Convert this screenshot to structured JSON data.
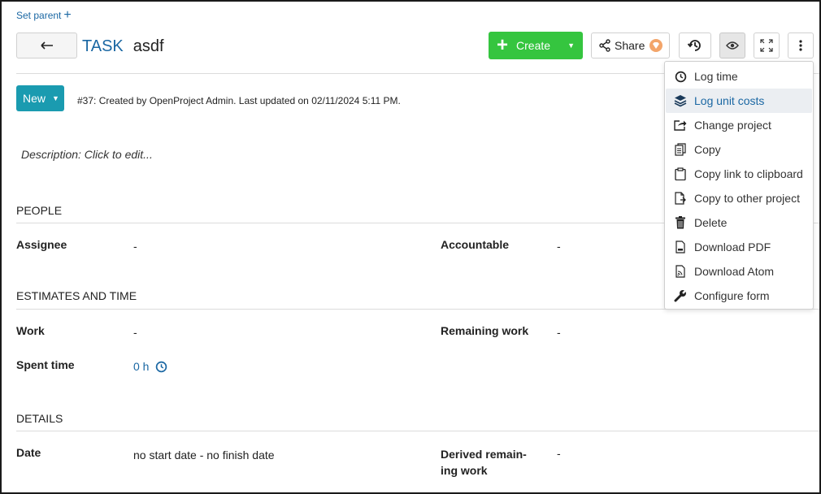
{
  "header": {
    "set_parent": "Set parent",
    "type": "TASK",
    "subject": "asdf",
    "create_label": "Create",
    "share_label": "Share"
  },
  "status": {
    "label": "New",
    "meta": "#37: Created by OpenProject Admin. Last updated on 02/11/2024 5:11 PM."
  },
  "description_placeholder": "Description: Click to edit...",
  "sections": {
    "people": {
      "title": "PEOPLE",
      "assignee_label": "Assignee",
      "assignee_value": "-",
      "accountable_label": "Accountable",
      "accountable_value": "-"
    },
    "estimates": {
      "title": "ESTIMATES AND TIME",
      "work_label": "Work",
      "work_value": "-",
      "remaining_label": "Remaining work",
      "remaining_value": "-",
      "spent_label": "Spent time",
      "spent_value": "0 h"
    },
    "details": {
      "title": "DETAILS",
      "date_label": "Date",
      "date_value": "no start date - no finish date",
      "derived_label_1": "Derived remain-",
      "derived_label_2": "ing work",
      "derived_value": "-"
    }
  },
  "menu": {
    "items": [
      {
        "label": "Log time",
        "icon": "clock-icon"
      },
      {
        "label": "Log unit costs",
        "icon": "layers-icon"
      },
      {
        "label": "Change project",
        "icon": "move-icon"
      },
      {
        "label": "Copy",
        "icon": "copy-icon"
      },
      {
        "label": "Copy link to clipboard",
        "icon": "clipboard-icon"
      },
      {
        "label": "Copy to other project",
        "icon": "copy-file-icon"
      },
      {
        "label": "Delete",
        "icon": "trash-icon"
      },
      {
        "label": "Download PDF",
        "icon": "pdf-icon"
      },
      {
        "label": "Download Atom",
        "icon": "atom-icon"
      },
      {
        "label": "Configure form",
        "icon": "wrench-icon"
      }
    ]
  },
  "colors": {
    "primary": "#1a67a3",
    "create": "#35c53f",
    "status": "#1a9bb0"
  }
}
